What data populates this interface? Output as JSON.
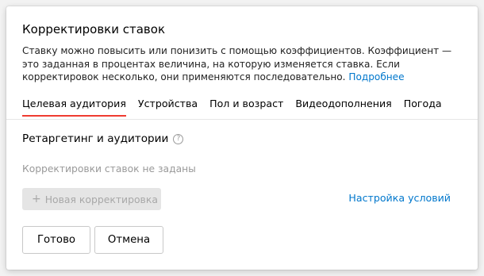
{
  "dialog": {
    "title": "Корректировки ставок",
    "description": "Ставку можно повысить или понизить с помощью коэффициентов. Коэффициент — это заданная в процентах величина, на которую изменяется ставка. Если корректировок несколько, они применяются последовательно.",
    "more_link": "Подробнее"
  },
  "tabs": [
    {
      "label": "Целевая аудитория",
      "active": true
    },
    {
      "label": "Устройства",
      "active": false
    },
    {
      "label": "Пол и возраст",
      "active": false
    },
    {
      "label": "Видеодополнения",
      "active": false
    },
    {
      "label": "Погода",
      "active": false
    }
  ],
  "section": {
    "title": "Ретаргетинг и аудитории",
    "help_icon": "?",
    "empty_text": "Корректировки ставок не заданы",
    "add_icon": "+",
    "add_label": "Новая корректировка",
    "conditions_link": "Настройка условий"
  },
  "footer": {
    "ok_label": "Готово",
    "cancel_label": "Отмена"
  },
  "colors": {
    "accent_tab_underline": "#ef3b30",
    "link": "#0077cc",
    "disabled_button_bg": "#e5e5e5"
  }
}
